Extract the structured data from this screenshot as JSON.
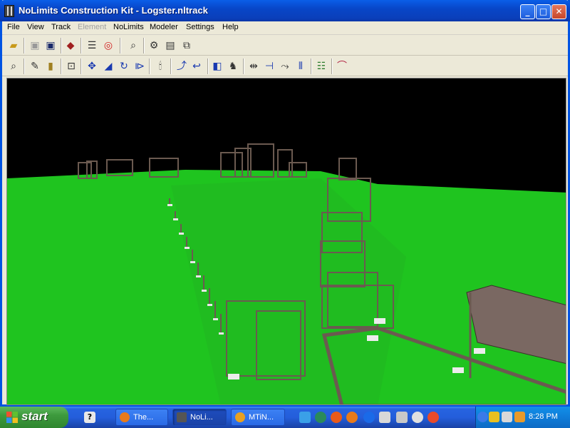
{
  "window": {
    "title": "NoLimits Construction Kit - Logster.nltrack",
    "controls": {
      "minimize": "_",
      "maximize": "□",
      "close": "✕"
    }
  },
  "menu": {
    "items": [
      {
        "label": "File",
        "enabled": true
      },
      {
        "label": "View",
        "enabled": true
      },
      {
        "label": "Track",
        "enabled": true
      },
      {
        "label": "Element",
        "enabled": false
      },
      {
        "label": "NoLimits",
        "enabled": true
      },
      {
        "label": "Modeler",
        "enabled": true
      },
      {
        "label": "Settings",
        "enabled": true
      },
      {
        "label": "Help",
        "enabled": true
      }
    ]
  },
  "toolbar1": {
    "icons": [
      "open-icon",
      "save-disabled-icon",
      "save-icon",
      "shapes-icon",
      "list-icon",
      "lifebuoy-icon",
      "zoom-icon",
      "track-settings-icon",
      "properties-icon",
      "layers-icon"
    ]
  },
  "toolbar2": {
    "icons": [
      "zoom-view-icon",
      "wrench-icon",
      "chart-icon",
      "vertex-icon",
      "move-icon",
      "bank-icon",
      "rotate-icon",
      "split-icon",
      "torch-icon",
      "curve-icon",
      "reverse-icon",
      "support-icon",
      "person-icon",
      "connector-icon",
      "beam-icon",
      "path-icon",
      "align-icon",
      "catwalk-icon",
      "arc-icon"
    ]
  },
  "scene": {
    "sky_color": "#000000",
    "ground_color": "#1fc41f",
    "structure_color": "#6b5a50"
  },
  "taskbar": {
    "start_label": "start",
    "tasks": [
      {
        "label": "The...",
        "active": false
      },
      {
        "label": "NoLi...",
        "active": true
      },
      {
        "label": "MTiN...",
        "active": false
      }
    ],
    "clock": "8:28 PM"
  }
}
